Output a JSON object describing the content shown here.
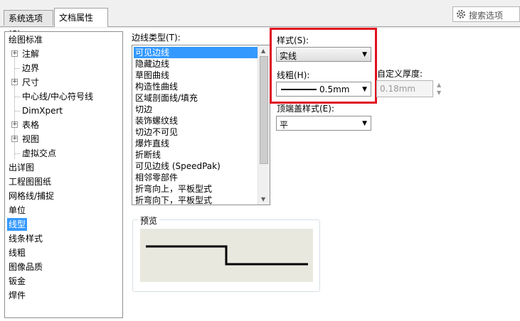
{
  "tabs": [
    {
      "label": "系统选项(S)"
    },
    {
      "label": "文档属性(D)"
    }
  ],
  "search": {
    "placeholder": "搜索选项"
  },
  "tree": {
    "items": [
      {
        "label": "绘图标准"
      },
      {
        "label": "注解"
      },
      {
        "label": "边界"
      },
      {
        "label": "尺寸"
      },
      {
        "label": "中心线/中心符号线"
      },
      {
        "label": "DimXpert"
      },
      {
        "label": "表格"
      },
      {
        "label": "视图"
      },
      {
        "label": "虚拟交点"
      },
      {
        "label": "出详图"
      },
      {
        "label": "工程图图纸"
      },
      {
        "label": "网格线/捕捉"
      },
      {
        "label": "单位"
      },
      {
        "label": "线型"
      },
      {
        "label": "线条样式"
      },
      {
        "label": "线粗"
      },
      {
        "label": "图像品质"
      },
      {
        "label": "钣金"
      },
      {
        "label": "焊件"
      }
    ]
  },
  "edge_types": {
    "label": "边线类型(T):",
    "items": [
      "可见边线",
      "隐藏边线",
      "草图曲线",
      "构造性曲线",
      "区域剖面线/填充",
      "切边",
      "装饰螺纹线",
      "切边不可见",
      "爆炸直线",
      "折断线",
      "可见边线 (SpeedPak)",
      "相邻零部件",
      "折弯向上，平板型式",
      "折弯向下，平板型式"
    ],
    "selected": "可见边线"
  },
  "style": {
    "label": "样式(S):",
    "value": "实线"
  },
  "thickness": {
    "label": "线粗(H):",
    "value": "0.5mm"
  },
  "custom_thickness": {
    "label": "自定义厚度:",
    "value": "0.18mm"
  },
  "end_cap": {
    "label": "顶端盖样式(E):",
    "value": "平"
  },
  "preview": {
    "label": "预览"
  },
  "colors": {
    "accent": "#3399ff",
    "highlight": "#e01020"
  }
}
